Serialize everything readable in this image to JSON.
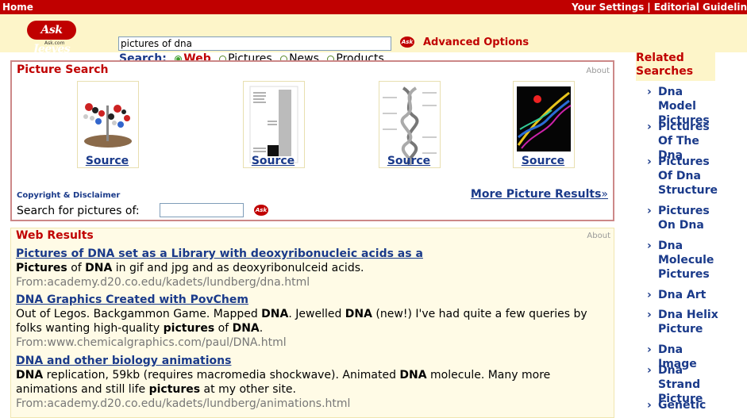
{
  "topbar": {
    "home": "Home",
    "settings": "Your Settings",
    "separator": "|",
    "editorial": "Editorial Guidelin"
  },
  "logo": {
    "text": "Ask Jeeves",
    "sub": "Ask.com",
    "icon": "ask-jeeves-logo"
  },
  "search": {
    "query": "pictures of dna",
    "advanced": "Advanced Options",
    "label": "Search:",
    "options": [
      "Web",
      "Pictures",
      "News",
      "Products"
    ],
    "selected": "Web"
  },
  "picture_search": {
    "title": "Picture Search",
    "about": "About",
    "thumbnails": [
      {
        "source": "Source",
        "depicts": "dna-model"
      },
      {
        "source": "Source",
        "depicts": "bar-chart"
      },
      {
        "source": "Source",
        "depicts": "double-helix"
      },
      {
        "source": "Source",
        "depicts": "molecule-render"
      }
    ],
    "copyright": "Copyright & Disclaimer",
    "more": "More Picture Results",
    "more_suffix": "»",
    "search_label": "Search for pictures of:"
  },
  "web_results": {
    "title": "Web Results",
    "about": "About",
    "results": [
      {
        "title": "Pictures of DNA set as a Library with deoxyribonucleic acids as a",
        "desc_html": "<b>Pictures</b> of <b>DNA</b> in gif and jpg and as deoxyribonulceid acids.",
        "url": "From:academy.d20.co.edu/kadets/lundberg/dna.html"
      },
      {
        "title": "DNA Graphics Created with PovChem",
        "desc_html": "Out of Legos. Backgammon Game. Mapped <b>DNA</b>. Jewelled <b>DNA</b> (new!) I've had quite a few queries by folks wanting high-quality <b>pictures</b> of <b>DNA</b>.",
        "url": "From:www.chemicalgraphics.com/paul/DNA.html"
      },
      {
        "title": "DNA and other biology animations",
        "desc_html": "<b>DNA</b> replication, 59kb (requires macromedia shockwave). Animated <b>DNA</b> molecule. Many more animations and still life <b>pictures</b> at my other site.",
        "url": "From:academy.d20.co.edu/kadets/lundberg/animations.html"
      }
    ]
  },
  "related": {
    "title": "Related Searches",
    "items": [
      "Dna Model Pictures",
      "Pictures Of The Dna",
      "Pictures Of Dna Structure",
      "Pictures On Dna",
      "Dna Molecule Pictures",
      "Dna Art",
      "Dna Helix Picture",
      "Dna Image",
      "Dna Strand Picture",
      "Genetic"
    ],
    "arrow": "›"
  },
  "colors": {
    "brand_red": "#c00000",
    "link_blue": "#1a3a8a",
    "band_yellow": "#fdf5c9"
  }
}
